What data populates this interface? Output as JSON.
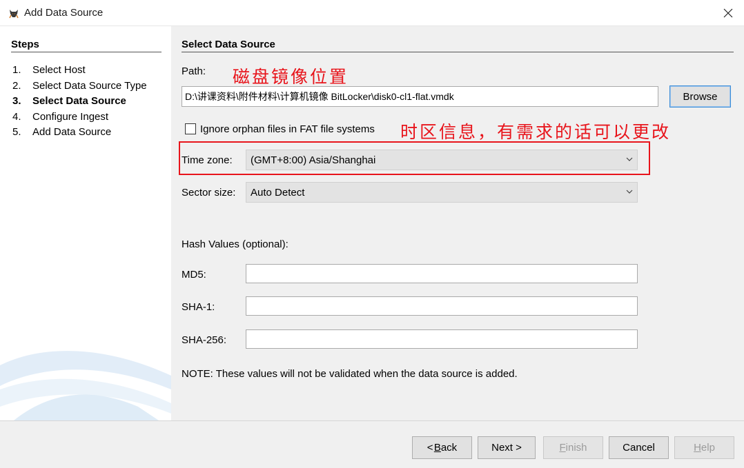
{
  "window": {
    "title": "Add Data Source",
    "close_icon": "close-icon",
    "app_icon": "autopsy-dog-icon"
  },
  "steps": {
    "heading": "Steps",
    "items": [
      {
        "num": "1.",
        "label": "Select Host",
        "active": false
      },
      {
        "num": "2.",
        "label": "Select Data Source Type",
        "active": false
      },
      {
        "num": "3.",
        "label": "Select Data Source",
        "active": true
      },
      {
        "num": "4.",
        "label": "Configure Ingest",
        "active": false
      },
      {
        "num": "5.",
        "label": "Add Data Source",
        "active": false
      }
    ]
  },
  "main": {
    "title": "Select Data Source",
    "path_label": "Path:",
    "path_value": "D:\\讲课资料\\附件材料\\计算机镜像 BitLocker\\disk0-cl1-flat.vmdk",
    "browse_label": "Browse",
    "ignore_orphan_label": "Ignore orphan files in FAT file systems",
    "ignore_orphan_checked": false,
    "timezone_label": "Time zone:",
    "timezone_value": "(GMT+8:00) Asia/Shanghai",
    "sector_label": "Sector size:",
    "sector_value": "Auto Detect",
    "hash_heading": "Hash Values (optional):",
    "md5_label": "MD5:",
    "sha1_label": "SHA-1:",
    "sha256_label": "SHA-256:",
    "md5_value": "",
    "sha1_value": "",
    "sha256_value": "",
    "note": "NOTE: These values will not be validated when the data source is added."
  },
  "annotations": {
    "path_note": "磁盘镜像位置",
    "timezone_note": "时区信息，有需求的话可以更改",
    "color": "#e8141b"
  },
  "footer": {
    "back_prefix": "< ",
    "back_key": "B",
    "back_rest": "ack",
    "next_label": "Next >",
    "finish_key": "F",
    "finish_rest": "inish",
    "cancel_label": "Cancel",
    "help_key": "H",
    "help_rest": "elp"
  }
}
